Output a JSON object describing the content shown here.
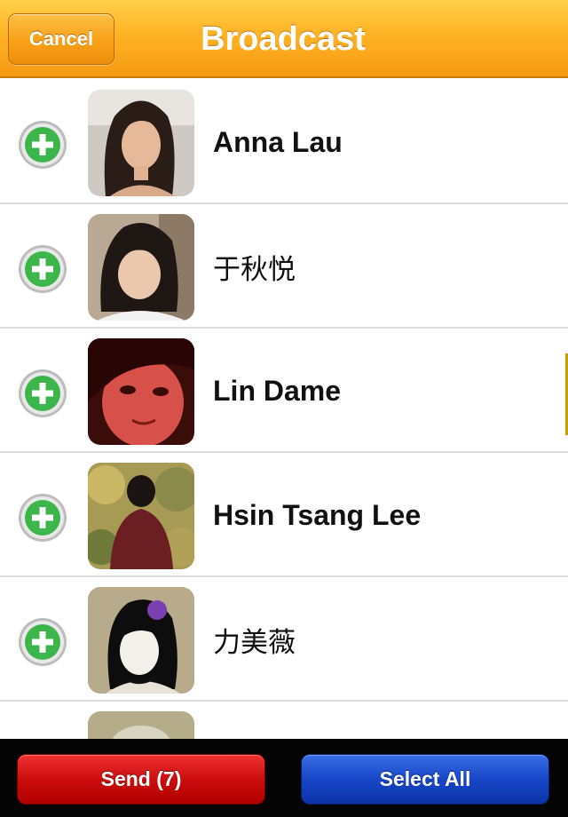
{
  "header": {
    "cancel_label": "Cancel",
    "title": "Broadcast"
  },
  "contacts": [
    {
      "name": "Anna Lau"
    },
    {
      "name": "于秋悦"
    },
    {
      "name": "Lin Dame"
    },
    {
      "name": "Hsin Tsang Lee"
    },
    {
      "name": "力美薇"
    }
  ],
  "toolbar": {
    "send_label": "Send (7)",
    "select_all_label": "Select All"
  },
  "colors": {
    "navbar": "#f7a51a",
    "add_icon": "#3cb54a",
    "send": "#cc0d0d",
    "select_all": "#1746c8"
  }
}
